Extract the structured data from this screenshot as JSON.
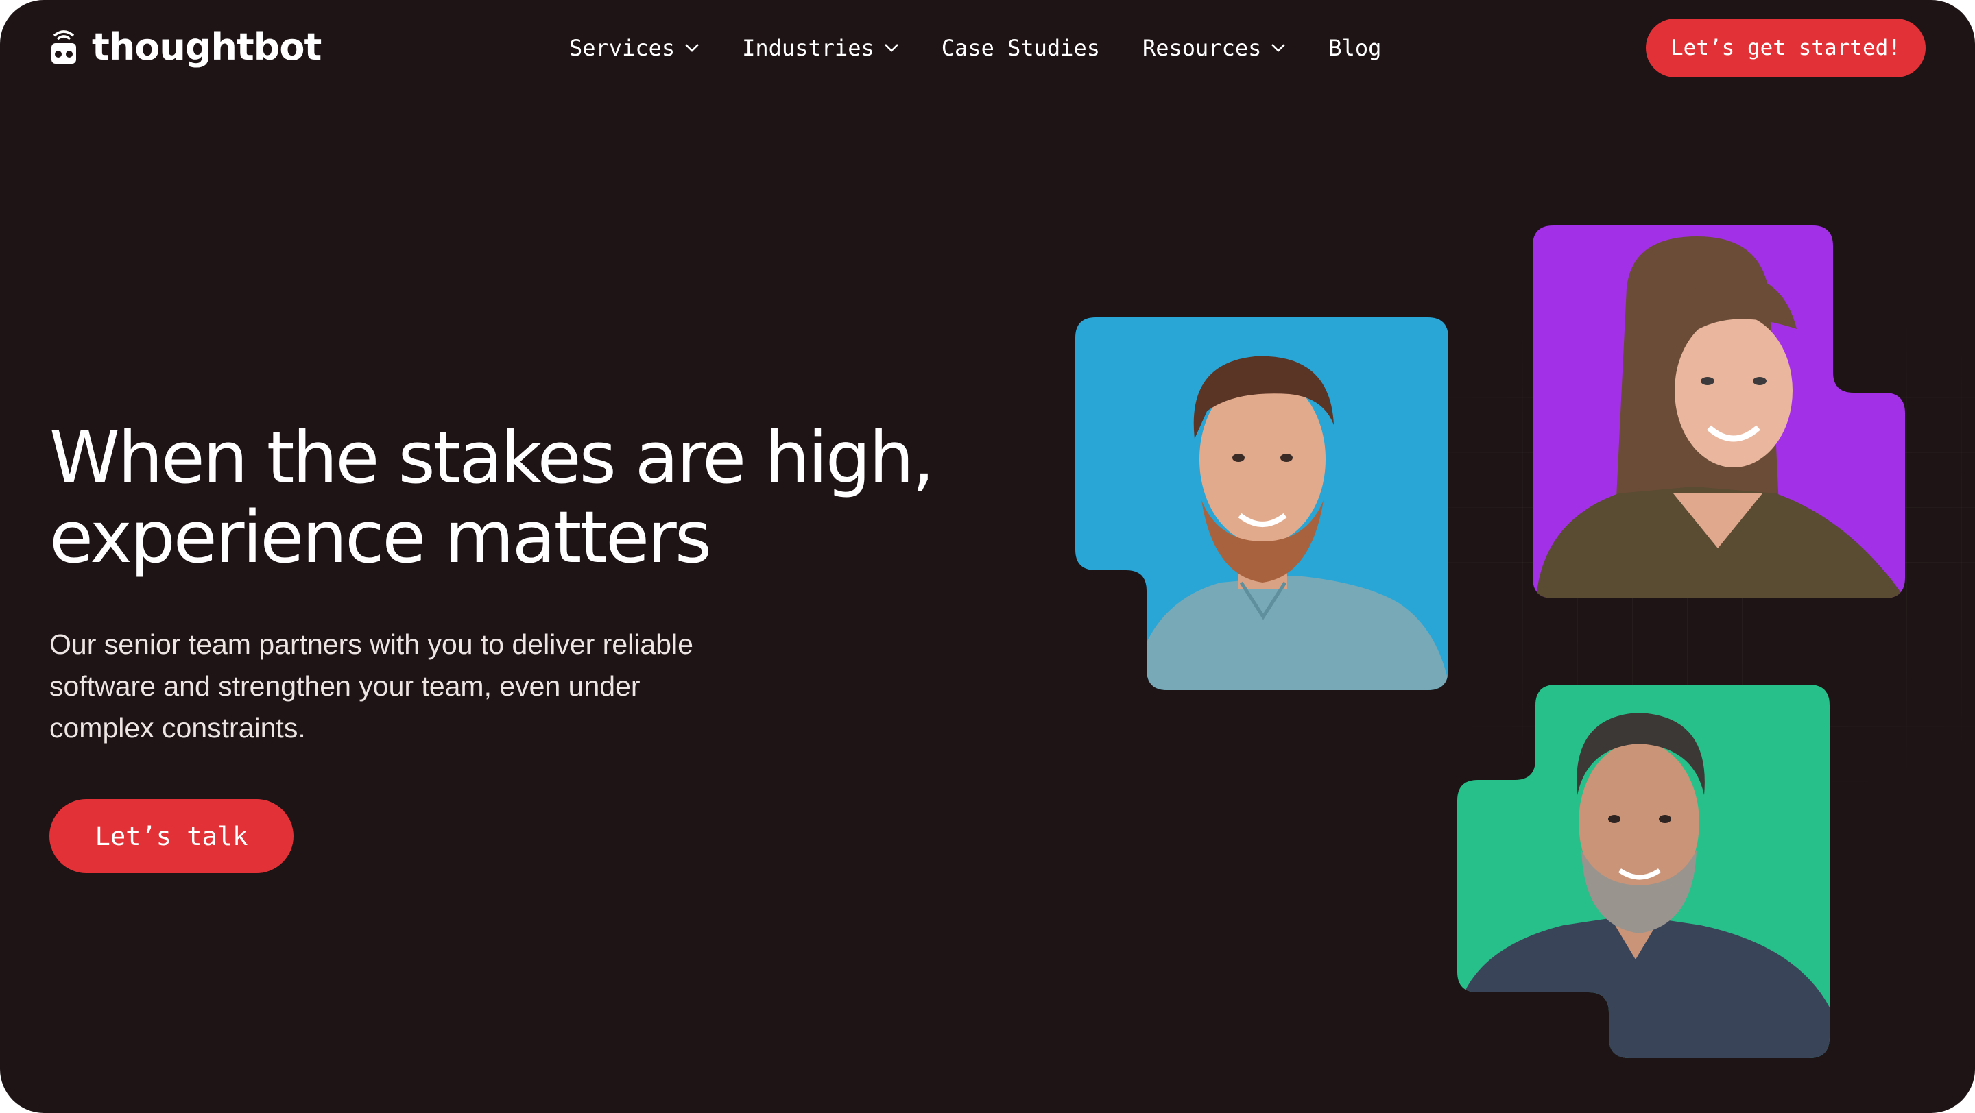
{
  "brand": {
    "name": "thoughtbot",
    "accent": "#e33237",
    "background": "#1e1415"
  },
  "nav": {
    "items": [
      {
        "label": "Services",
        "has_dropdown": true
      },
      {
        "label": "Industries",
        "has_dropdown": true
      },
      {
        "label": "Case Studies",
        "has_dropdown": false
      },
      {
        "label": "Resources",
        "has_dropdown": true
      },
      {
        "label": "Blog",
        "has_dropdown": false
      }
    ],
    "cta_label": "Let’s get started!"
  },
  "hero": {
    "headline_line1": "When the stakes are high,",
    "headline_line2": "experience matters",
    "subtext": "Our senior team partners with you to deliver reliable software and strengthen your team, even under complex constraints.",
    "cta_label": "Let’s talk"
  },
  "team_photos": [
    {
      "name": "team-photo-blue",
      "bg_color": "#29a6d6",
      "shirt_color": "#78a9b7",
      "hair_color": "#5a3526"
    },
    {
      "name": "team-photo-purple",
      "bg_color": "#a230e6",
      "shirt_color": "#5a4b33",
      "hair_color": "#6b4c37"
    },
    {
      "name": "team-photo-green",
      "bg_color": "#27bf8a",
      "shirt_color": "#3a4458",
      "hair_color": "#3c3836"
    }
  ]
}
